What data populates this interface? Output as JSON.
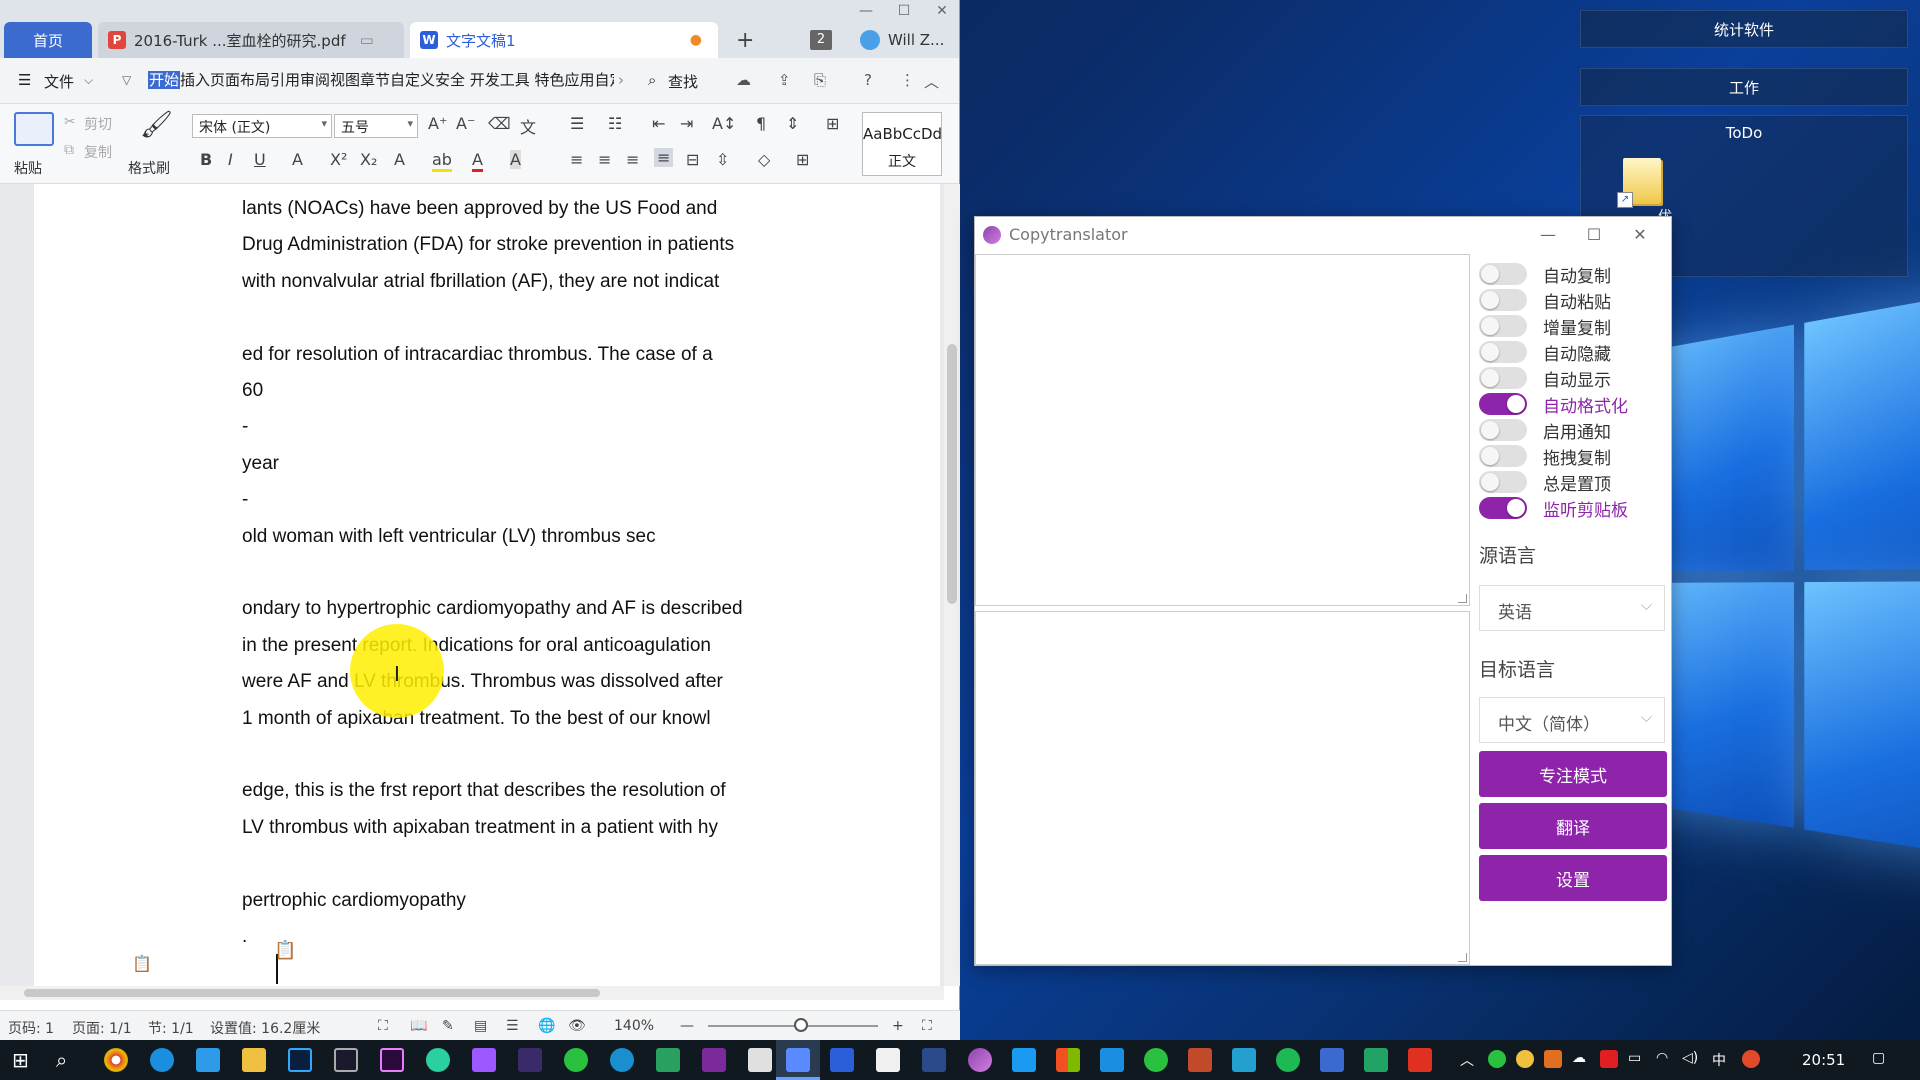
{
  "desktop": {
    "buttons": [
      "统计软件",
      "工作",
      "ToDo"
    ],
    "icon_label": "优\n..."
  },
  "wps": {
    "tabs": {
      "home": "首页",
      "pdf": "2016-Turk ...室血栓的研究.pdf",
      "doc": "文字文稿1"
    },
    "tab_count": "2",
    "user": "Will Z...",
    "menu": {
      "file": "文件",
      "ribbon_selected": "开始",
      "ribbon_rest": "插入页面布局引用审阅视图章节自定义安全 开发工具 特色应用自定",
      "find": "查找"
    },
    "toolbar": {
      "paste": "粘贴",
      "cut": "剪切",
      "copy": "复制",
      "format_painter": "格式刷",
      "font": "宋体 (正文)",
      "size": "五号",
      "style_preview": "AaBbCcDd",
      "style_name": "正文"
    },
    "document_lines": [
      "lants (NOACs) have been approved by the US Food and",
      "Drug Administration (FDA) for stroke prevention in patients",
      "with nonvalvular atrial fbrillation (AF), they are not indicat",
      "",
      "ed for resolution of intracardiac thrombus. The case of a",
      "60",
      "-",
      "year",
      "-",
      "old woman with left ventricular (LV) thrombus sec",
      "",
      "ondary to hypertrophic cardiomyopathy and AF is described",
      "in the present report. Indications for oral anticoagulation",
      "were AF and LV thrombus. Thrombus was dissolved after",
      "1 month of apixaban treatment. To the best of our knowl",
      "",
      "edge, this is the frst report that describes the resolution of",
      "LV thrombus with apixaban treatment in a patient with hy",
      "",
      "pertrophic cardiomyopathy",
      "."
    ],
    "status": {
      "page_code": "页码: 1",
      "page": "页面: 1/1",
      "section": "节: 1/1",
      "setting": "设置值: 16.2厘米",
      "zoom": "140%"
    }
  },
  "copytranslator": {
    "title": "Copytranslator",
    "toggles": [
      {
        "label": "自动复制",
        "on": false
      },
      {
        "label": "自动粘贴",
        "on": false
      },
      {
        "label": "增量复制",
        "on": false
      },
      {
        "label": "自动隐藏",
        "on": false
      },
      {
        "label": "自动显示",
        "on": false
      },
      {
        "label": "自动格式化",
        "on": true
      },
      {
        "label": "启用通知",
        "on": false
      },
      {
        "label": "拖拽复制",
        "on": false
      },
      {
        "label": "总是置顶",
        "on": false
      },
      {
        "label": "监听剪贴板",
        "on": true
      }
    ],
    "source_label": "源语言",
    "source_value": "英语",
    "target_label": "目标语言",
    "target_value": "中文（简体）",
    "buttons": {
      "focus": "专注模式",
      "translate": "翻译",
      "settings": "设置"
    },
    "accent": "#8e24aa"
  },
  "taskbar": {
    "ime": "中",
    "time": "20:51"
  }
}
